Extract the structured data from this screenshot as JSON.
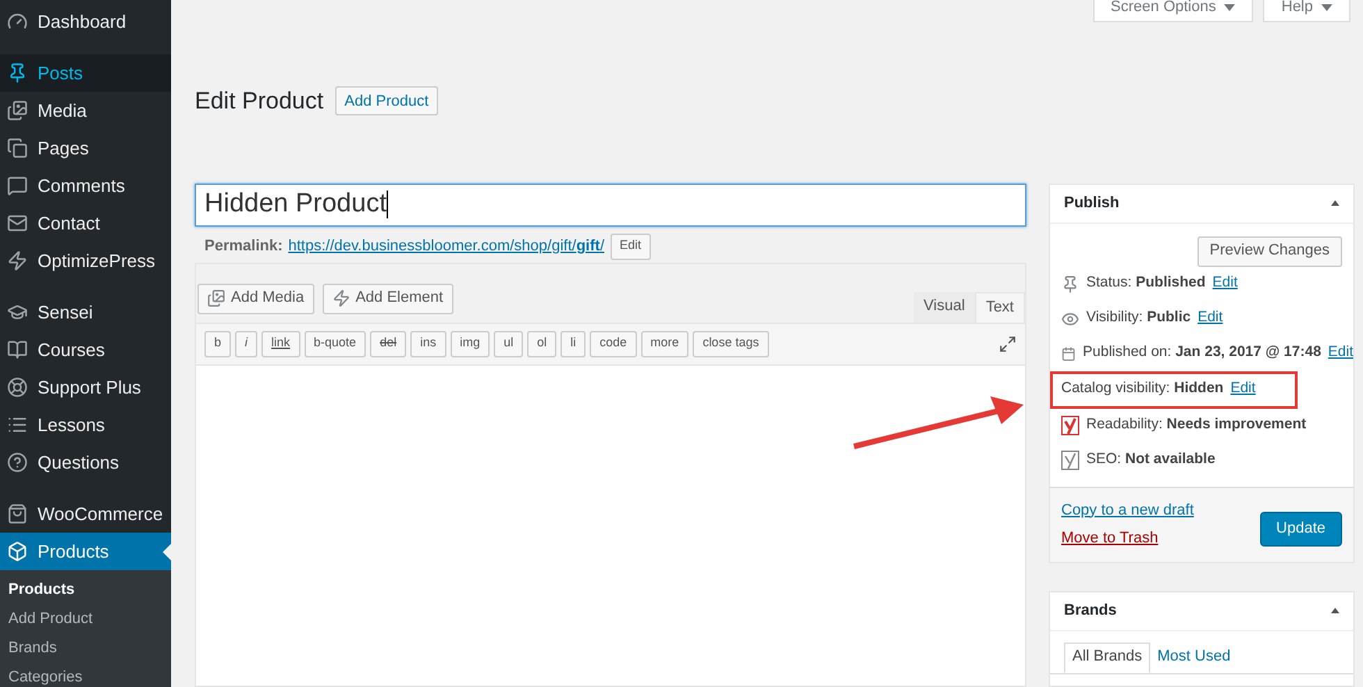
{
  "sidebar": {
    "groups": [
      {
        "items": [
          {
            "kind": "dashboard",
            "label": "Dashboard",
            "selected": false,
            "highlighted": false
          }
        ]
      },
      {
        "items": [
          {
            "kind": "pin",
            "label": "Posts",
            "selected": false,
            "highlighted": true
          },
          {
            "kind": "media",
            "label": "Media",
            "selected": false,
            "highlighted": false
          },
          {
            "kind": "pages",
            "label": "Pages",
            "selected": false,
            "highlighted": false
          },
          {
            "kind": "comments",
            "label": "Comments",
            "selected": false,
            "highlighted": false
          },
          {
            "kind": "mail",
            "label": "Contact",
            "selected": false,
            "highlighted": false
          },
          {
            "kind": "bolt",
            "label": "OptimizePress",
            "selected": false,
            "highlighted": false
          }
        ]
      },
      {
        "items": [
          {
            "kind": "cap",
            "label": "Sensei",
            "selected": false,
            "highlighted": false
          },
          {
            "kind": "book",
            "label": "Courses",
            "selected": false,
            "highlighted": false
          },
          {
            "kind": "lifebuoy",
            "label": "Support Plus",
            "selected": false,
            "highlighted": false
          },
          {
            "kind": "list",
            "label": "Lessons",
            "selected": false,
            "highlighted": false
          },
          {
            "kind": "help",
            "label": "Questions",
            "selected": false,
            "highlighted": false
          }
        ]
      },
      {
        "items": [
          {
            "kind": "woo",
            "label": "WooCommerce",
            "selected": false,
            "highlighted": false
          },
          {
            "kind": "box",
            "label": "Products",
            "selected": true,
            "highlighted": false
          }
        ]
      }
    ],
    "submenu": [
      {
        "label": "Products",
        "selected": true
      },
      {
        "label": "Add Product",
        "selected": false
      },
      {
        "label": "Brands",
        "selected": false
      },
      {
        "label": "Categories",
        "selected": false
      }
    ]
  },
  "top_buttons": [
    "Screen Options",
    "Help"
  ],
  "heading": {
    "title": "Edit Product",
    "button": "Add Product"
  },
  "title_field": {
    "value": "Hidden Product"
  },
  "permalink": {
    "label": "Permalink:",
    "url": "https://dev.businessbloomer.com/shop/gift/**gift**/",
    "button": "Edit"
  },
  "editor": {
    "media_buttons": [
      {
        "kind": "media",
        "label": "Add Media"
      },
      {
        "kind": "bolt",
        "label": "Add Element"
      }
    ],
    "tabs": [
      {
        "label": "Visual",
        "selected": false
      },
      {
        "label": "Text",
        "selected": true
      }
    ],
    "quicktags": [
      "b",
      "i",
      "link",
      "b-quote",
      "del",
      "ins",
      "img",
      "ul",
      "ol",
      "li",
      "code",
      "more",
      "close tags"
    ]
  },
  "publish": {
    "title": "Publish",
    "preview_button": "Preview Changes",
    "rows": [
      {
        "kind": "pin",
        "text": "Status: **Published**",
        "link": "Edit",
        "highlighted": false
      },
      {
        "kind": "eye",
        "text": "Visibility: **Public**",
        "link": "Edit",
        "highlighted": false
      },
      {
        "kind": "calendar",
        "text": "Published on: **Jan 23, 2017 @ 17:48**",
        "link": "Edit",
        "highlighted": false
      },
      {
        "kind": "plain",
        "text": "Catalog visibility: **Hidden**",
        "link": "Edit",
        "highlighted": true
      },
      {
        "kind": "yoast-red",
        "text": "Readability: **Needs improvement**",
        "highlighted": false
      },
      {
        "kind": "yoast-grey",
        "text": "SEO: **Not available**",
        "highlighted": false
      }
    ],
    "copy_link": "Copy to a new draft",
    "trash_link": "Move to Trash",
    "update_button": "Update"
  },
  "brands": {
    "title": "Brands",
    "tabs": [
      {
        "label": "All Brands",
        "selected": true
      },
      {
        "label": "Most Used",
        "selected": false
      }
    ]
  }
}
